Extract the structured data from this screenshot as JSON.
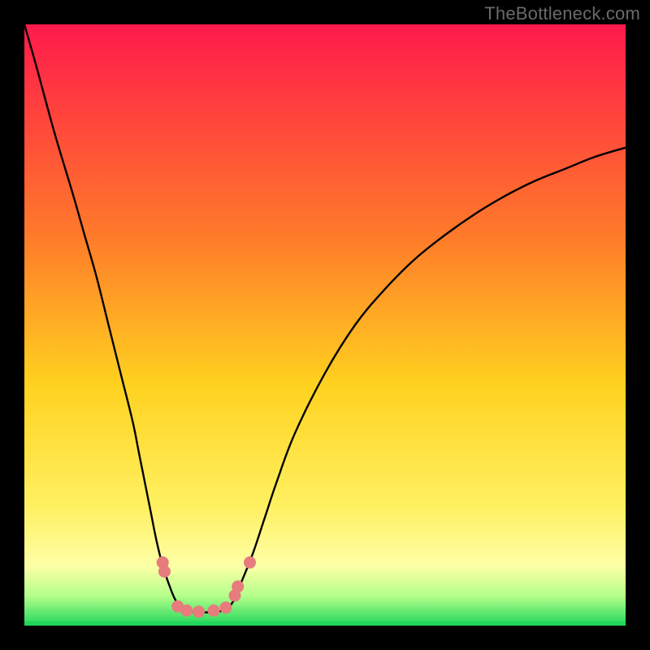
{
  "watermark": "TheBottleneck.com",
  "colors": {
    "gradient_top": "#ff1a4b",
    "gradient_upper_mid": "#ff7a2a",
    "gradient_mid": "#ffd21f",
    "gradient_lower_mid": "#fff060",
    "gradient_low": "#fdffa6",
    "gradient_bottom_band": "#b6ff8c",
    "gradient_bottom_line": "#1fd65a",
    "curve": "#000000",
    "marker": "#e77b7d",
    "marker_stroke": "#d15b5d"
  },
  "chart_data": {
    "type": "line",
    "title": "",
    "xlabel": "",
    "ylabel": "",
    "xlim": [
      0,
      100
    ],
    "ylim": [
      0,
      100
    ],
    "series": [
      {
        "name": "left-branch",
        "x": [
          0,
          2,
          5,
          8,
          10,
          12,
          14,
          16,
          18,
          19,
          20,
          21,
          22,
          23,
          24,
          25,
          26,
          27
        ],
        "y": [
          100,
          93,
          82,
          72,
          65,
          58,
          50,
          42,
          34,
          29,
          24,
          19,
          14,
          10,
          7,
          4.5,
          3,
          2.5
        ]
      },
      {
        "name": "flat-bottom",
        "x": [
          27,
          28,
          29,
          30,
          31,
          32,
          33,
          34
        ],
        "y": [
          2.5,
          2.3,
          2.2,
          2.2,
          2.2,
          2.3,
          2.5,
          3
        ]
      },
      {
        "name": "right-branch",
        "x": [
          34,
          35,
          36,
          38,
          40,
          42,
          45,
          50,
          55,
          60,
          65,
          70,
          75,
          80,
          85,
          90,
          95,
          100
        ],
        "y": [
          3,
          4.5,
          7,
          12,
          18,
          24,
          32,
          42,
          50,
          56,
          61,
          65,
          68.5,
          71.5,
          74,
          76,
          78,
          79.5
        ]
      }
    ],
    "markers": [
      {
        "x": 23,
        "y": 10.5
      },
      {
        "x": 23.3,
        "y": 9
      },
      {
        "x": 25.5,
        "y": 3.2
      },
      {
        "x": 27,
        "y": 2.5
      },
      {
        "x": 29,
        "y": 2.3
      },
      {
        "x": 31.5,
        "y": 2.5
      },
      {
        "x": 33.5,
        "y": 3
      },
      {
        "x": 35,
        "y": 5
      },
      {
        "x": 35.5,
        "y": 6.5
      },
      {
        "x": 37.5,
        "y": 10.5
      }
    ]
  }
}
